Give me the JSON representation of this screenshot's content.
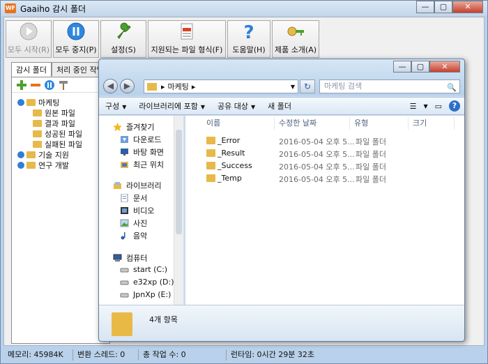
{
  "app": {
    "logo": "WF",
    "title": "Gaaiho 감시 폴더",
    "min_glyph": "—",
    "max_glyph": "▢",
    "close_glyph": "✕"
  },
  "toolbar": {
    "start_all": "모두 시작(R)",
    "stop_all": "모두 중지(P)",
    "settings": "설정(S)",
    "file_formats": "지원되는 파일 형식(F)",
    "help": "도움말(H)",
    "about": "제품 소개(A)"
  },
  "tabs": [
    "감시 폴더",
    "처리 중인 작업"
  ],
  "tree": {
    "root1": "마케팅",
    "children": [
      "원본 파일",
      "결과 파일",
      "성공된 파일",
      "실패된 파일"
    ],
    "root2": "기술 지원",
    "root3": "연구 개발"
  },
  "statusbar": {
    "memory": "메모리: 45984K",
    "threads": "변환 스레드: 0",
    "jobs": "총 작업 수: 0",
    "runtime": "런타임: 0시간 29분 32초"
  },
  "explorer": {
    "back": "◀",
    "forward": "▶",
    "address": "마케팅",
    "address_sep": "▸",
    "address_drop": "▼",
    "refresh_glyph": "↻",
    "search_placeholder": "마케팅 검색",
    "search_glyph": "🔍",
    "commands": [
      "구성",
      "라이브러리에 포함",
      "공유 대상",
      "새 폴더"
    ],
    "cmd_arrow": "▼",
    "view_glyph": "☰",
    "pane_glyph": "▭",
    "help_glyph": "?",
    "nav": {
      "favorites": "즐겨찾기",
      "downloads": "다운로드",
      "desktop": "바탕 화면",
      "recent": "최근 위치",
      "libraries": "라이브러리",
      "documents": "문서",
      "videos": "비디오",
      "pictures": "사진",
      "music": "음악",
      "computer": "컴퓨터",
      "drive_c": "start (C:)",
      "drive_d": "e32xp (D:)",
      "drive_e": "JpnXp (E:)"
    },
    "columns": [
      "이름",
      "수정한 날짜",
      "유형",
      "크기"
    ],
    "files": [
      {
        "name": "_Error",
        "date": "2016-05-04 오후 5...",
        "type": "파일 폴더"
      },
      {
        "name": "_Result",
        "date": "2016-05-04 오후 5...",
        "type": "파일 폴더"
      },
      {
        "name": "_Success",
        "date": "2016-05-04 오후 5...",
        "type": "파일 폴더"
      },
      {
        "name": "_Temp",
        "date": "2016-05-04 오후 5...",
        "type": "파일 폴더"
      }
    ],
    "item_count": "4개 항목"
  }
}
